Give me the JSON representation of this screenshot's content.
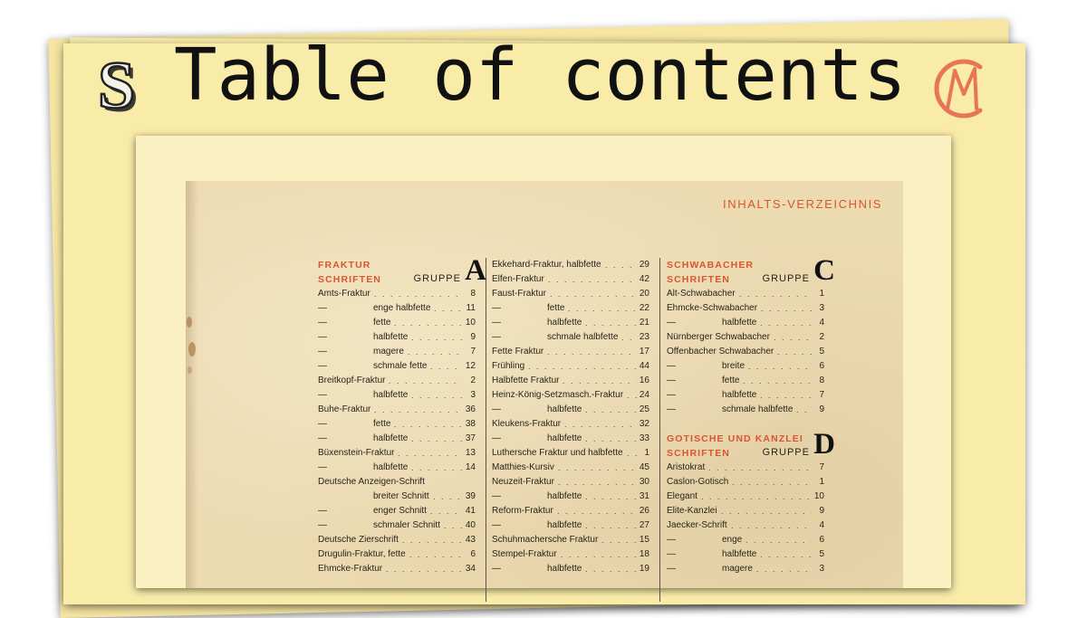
{
  "banner": {
    "title": "Table of contents",
    "left_logo": "s-monogram-logo",
    "right_logo": "cm-monogram-logo",
    "accent": "#e8755a"
  },
  "document": {
    "header": "INHALTS-VERZEICHNIS",
    "accent_color": "#d9562e",
    "columns": [
      {
        "section": {
          "name_line1": "FRAKTUR",
          "name_line2": "SCHRIFTEN",
          "group_label": "GRUPPE",
          "group_letter": "A"
        },
        "rows": [
          {
            "name": "Amts-Fraktur",
            "page": "8",
            "indent": false
          },
          {
            "dash": "—",
            "name": "enge halbfette",
            "page": "11",
            "indent": true
          },
          {
            "dash": "—",
            "name": "fette",
            "page": "10",
            "indent": true
          },
          {
            "dash": "—",
            "name": "halbfette",
            "page": "9",
            "indent": true
          },
          {
            "dash": "—",
            "name": "magere",
            "page": "7",
            "indent": true
          },
          {
            "dash": "—",
            "name": "schmale fette",
            "page": "12",
            "indent": true
          },
          {
            "name": "Breitkopf-Fraktur",
            "page": "2",
            "indent": false
          },
          {
            "dash": "—",
            "name": "halbfette",
            "page": "3",
            "indent": true
          },
          {
            "name": "Buhe-Fraktur",
            "page": "36",
            "indent": false
          },
          {
            "dash": "—",
            "name": "fette",
            "page": "38",
            "indent": true
          },
          {
            "dash": "—",
            "name": "halbfette",
            "page": "37",
            "indent": true
          },
          {
            "name": "Büxenstein-Fraktur",
            "page": "13",
            "indent": false
          },
          {
            "dash": "—",
            "name": "halbfette",
            "page": "14",
            "indent": true
          },
          {
            "name": "Deutsche Anzeigen-Schrift",
            "page": "",
            "indent": false
          },
          {
            "name": "breiter Schnitt",
            "page": "39",
            "indent": true
          },
          {
            "dash": "—",
            "name": "enger Schnitt",
            "page": "41",
            "indent": true
          },
          {
            "dash": "—",
            "name": "schmaler Schnitt",
            "page": "40",
            "indent": true
          },
          {
            "name": "Deutsche Zierschrift",
            "page": "43",
            "indent": false
          },
          {
            "name": "Drugulin-Fraktur, fette",
            "page": "6",
            "indent": false
          },
          {
            "name": "Ehmcke-Fraktur",
            "page": "34",
            "indent": false
          }
        ]
      },
      {
        "rows": [
          {
            "name": "Ekkehard-Fraktur, halbfette",
            "page": "29",
            "indent": false
          },
          {
            "name": "Elfen-Fraktur",
            "page": "42",
            "indent": false
          },
          {
            "name": "Faust-Fraktur",
            "page": "20",
            "indent": false
          },
          {
            "dash": "—",
            "name": "fette",
            "page": "22",
            "indent": true
          },
          {
            "dash": "—",
            "name": "halbfette",
            "page": "21",
            "indent": true
          },
          {
            "dash": "—",
            "name": "schmale halbfette",
            "page": "23",
            "indent": true
          },
          {
            "name": "Fette Fraktur",
            "page": "17",
            "indent": false
          },
          {
            "name": "Frühling",
            "page": "44",
            "indent": false
          },
          {
            "name": "Halbfette Fraktur",
            "page": "16",
            "indent": false
          },
          {
            "name": "Heinz-König-Setzmasch.-Fraktur",
            "page": "24",
            "indent": false
          },
          {
            "dash": "—",
            "name": "halbfette",
            "page": "25",
            "indent": true
          },
          {
            "name": "Kleukens-Fraktur",
            "page": "32",
            "indent": false
          },
          {
            "dash": "—",
            "name": "halbfette",
            "page": "33",
            "indent": true
          },
          {
            "name": "Luthersche Fraktur und halbfette",
            "page": "1",
            "indent": false
          },
          {
            "name": "Matthies-Kursiv",
            "page": "45",
            "indent": false
          },
          {
            "name": "Neuzeit-Fraktur",
            "page": "30",
            "indent": false
          },
          {
            "dash": "—",
            "name": "halbfette",
            "page": "31",
            "indent": true
          },
          {
            "name": "Reform-Fraktur",
            "page": "26",
            "indent": false
          },
          {
            "dash": "—",
            "name": "halbfette",
            "page": "27",
            "indent": true
          },
          {
            "name": "Schuhmachersche Fraktur",
            "page": "15",
            "indent": false
          },
          {
            "name": "Stempel-Fraktur",
            "page": "18",
            "indent": false
          },
          {
            "dash": "—",
            "name": "halbfette",
            "page": "19",
            "indent": true
          }
        ]
      },
      {
        "section": {
          "name_line1": "SCHWABACHER",
          "name_line2": "SCHRIFTEN",
          "group_label": "GRUPPE",
          "group_letter": "C"
        },
        "rows": [
          {
            "name": "Alt-Schwabacher",
            "page": "1",
            "indent": false
          },
          {
            "name": "Ehmcke-Schwabacher",
            "page": "3",
            "indent": false
          },
          {
            "dash": "—",
            "name": "halbfette",
            "page": "4",
            "indent": true
          },
          {
            "name": "Nürnberger Schwabacher",
            "page": "2",
            "indent": false
          },
          {
            "name": "Offenbacher Schwabacher",
            "page": "5",
            "indent": false
          },
          {
            "dash": "—",
            "name": "breite",
            "page": "6",
            "indent": true
          },
          {
            "dash": "—",
            "name": "fette",
            "page": "8",
            "indent": true
          },
          {
            "dash": "—",
            "name": "halbfette",
            "page": "7",
            "indent": true
          },
          {
            "dash": "—",
            "name": "schmale halbfette",
            "page": "9",
            "indent": true
          }
        ],
        "section2": {
          "name_line1": "GOTISCHE UND KANZLEI",
          "name_line2": "SCHRIFTEN",
          "group_label": "GRUPPE",
          "group_letter": "D"
        },
        "rows2": [
          {
            "name": "Aristokrat",
            "page": "7",
            "indent": false
          },
          {
            "name": "Caslon-Gotisch",
            "page": "1",
            "indent": false
          },
          {
            "name": "Elegant",
            "page": "10",
            "indent": false
          },
          {
            "name": "Elite-Kanzlei",
            "page": "9",
            "indent": false
          },
          {
            "name": "Jaecker-Schrift",
            "page": "4",
            "indent": false
          },
          {
            "dash": "—",
            "name": "enge",
            "page": "6",
            "indent": true
          },
          {
            "dash": "—",
            "name": "halbfette",
            "page": "5",
            "indent": true
          },
          {
            "dash": "—",
            "name": "magere",
            "page": "3",
            "indent": true
          }
        ]
      }
    ]
  }
}
